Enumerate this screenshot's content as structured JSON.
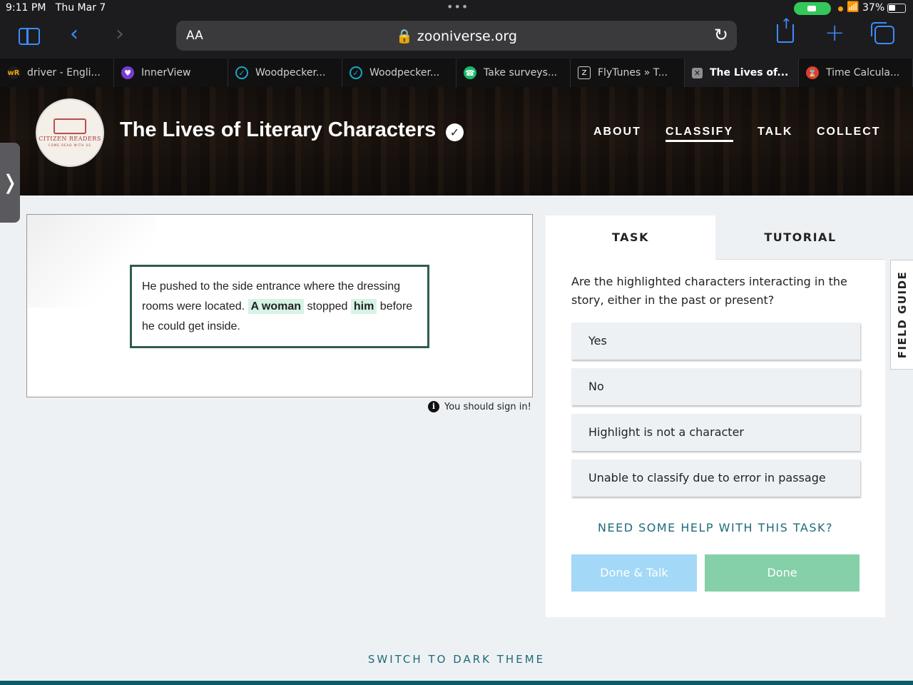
{
  "status_bar": {
    "time": "9:11 PM",
    "date": "Thu Mar 7",
    "battery": "37%"
  },
  "browser": {
    "text_size_label": "AA",
    "url": "zooniverse.org",
    "tabs": [
      {
        "label": "driver - Engli...",
        "favicon": "wr-icon",
        "color": "#f2a40a"
      },
      {
        "label": "InnerView",
        "favicon": "innerview-icon",
        "color": "#7a3bd1"
      },
      {
        "label": "Woodpecker...",
        "favicon": "woodpecker-icon",
        "color": "#1aa6c4"
      },
      {
        "label": "Woodpecker...",
        "favicon": "woodpecker-icon",
        "color": "#1aa6c4"
      },
      {
        "label": "Take surveys...",
        "favicon": "survey-icon",
        "color": "#19b86b"
      },
      {
        "label": "FlyTunes » T...",
        "favicon": "flytunes-icon",
        "color": "#333333"
      },
      {
        "label": "The Lives of...",
        "favicon": "close-tab-icon",
        "color": "#888888"
      },
      {
        "label": "Time Calcula...",
        "favicon": "hourglass-icon",
        "color": "#e03b2f"
      }
    ]
  },
  "project": {
    "logo_text": "CITIZEN READERS",
    "logo_tagline": "COME READ WITH US",
    "title": "The Lives of Literary Characters",
    "nav": [
      "ABOUT",
      "CLASSIFY",
      "TALK",
      "COLLECT"
    ]
  },
  "subject": {
    "before": "He pushed to the side entrance where the dressing rooms were located.",
    "highlight1": "A woman",
    "middle": "stopped",
    "highlight2": "him",
    "after": "before he could get inside.",
    "sign_in_notice": "You should sign in!"
  },
  "task_panel": {
    "tab_task": "TASK",
    "tab_tutorial": "TUTORIAL",
    "question": "Are the highlighted characters interacting in the story, either in the past or present?",
    "answers": [
      "Yes",
      "No",
      "Highlight is not a character",
      "Unable to classify due to error in passage"
    ],
    "help_link": "NEED SOME HELP WITH THIS TASK?",
    "done_talk_label": "Done & Talk",
    "done_label": "Done"
  },
  "field_guide_label": "FIELD GUIDE",
  "theme_switch_label": "SWITCH TO DARK THEME",
  "colors": {
    "accent": "#1d6b7a",
    "passage_border": "#2e5e4b",
    "highlight": "#d6f3e5",
    "done": "#85d0a8",
    "done_talk": "#a3d8f7"
  }
}
